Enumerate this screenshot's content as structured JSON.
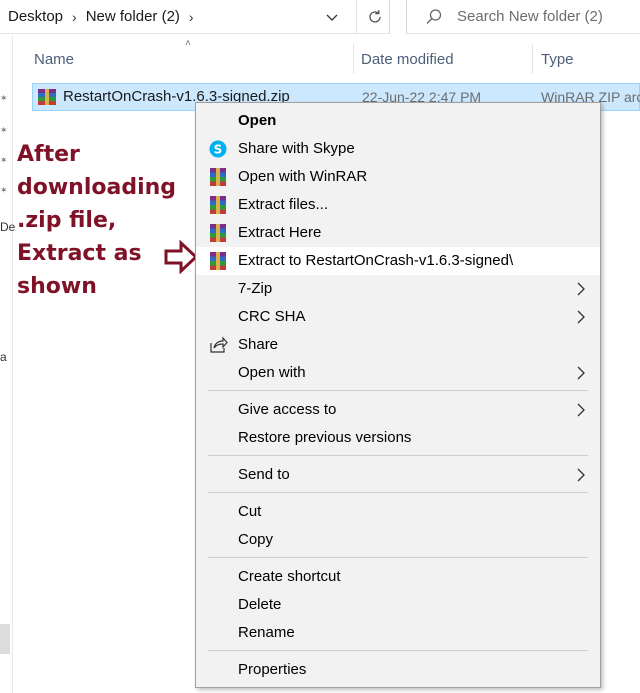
{
  "breadcrumb": {
    "items": [
      "Desktop",
      "New folder (2)"
    ]
  },
  "search": {
    "placeholder": "Search New folder (2)"
  },
  "columns": {
    "name": "Name",
    "date_modified": "Date modified",
    "type": "Type"
  },
  "file": {
    "name": "RestartOnCrash-v1.6.3-signed.zip",
    "date": "22-Jun-22 2:47 PM",
    "type": "WinRAR ZIP archive",
    "icon": "winrar-archive-icon"
  },
  "annotation": {
    "text": "After\ndownloading\n.zip file,\nExtract as\nshown",
    "color": "#7f1227"
  },
  "context_menu": {
    "items": [
      {
        "label": "Open",
        "bold": true
      },
      {
        "label": "Share with Skype",
        "icon": "skype-icon"
      },
      {
        "label": "Open with WinRAR",
        "icon": "winrar-icon"
      },
      {
        "label": "Extract files...",
        "icon": "winrar-icon"
      },
      {
        "label": "Extract Here",
        "icon": "winrar-icon"
      },
      {
        "label": "Extract to RestartOnCrash-v1.6.3-signed\\",
        "icon": "winrar-icon",
        "highlighted": true
      },
      {
        "label": "7-Zip",
        "submenu": true
      },
      {
        "label": "CRC SHA",
        "submenu": true
      },
      {
        "label": "Share",
        "icon": "share-icon"
      },
      {
        "label": "Open with",
        "submenu": true
      },
      {
        "label": "Give access to",
        "submenu": true
      },
      {
        "label": "Restore previous versions"
      },
      {
        "label": "Send to",
        "submenu": true
      },
      {
        "label": "Cut"
      },
      {
        "label": "Copy"
      },
      {
        "label": "Create shortcut"
      },
      {
        "label": "Delete"
      },
      {
        "label": "Rename"
      },
      {
        "label": "Properties"
      }
    ]
  },
  "left_pane": {
    "fragments": [
      "De",
      "a"
    ]
  }
}
